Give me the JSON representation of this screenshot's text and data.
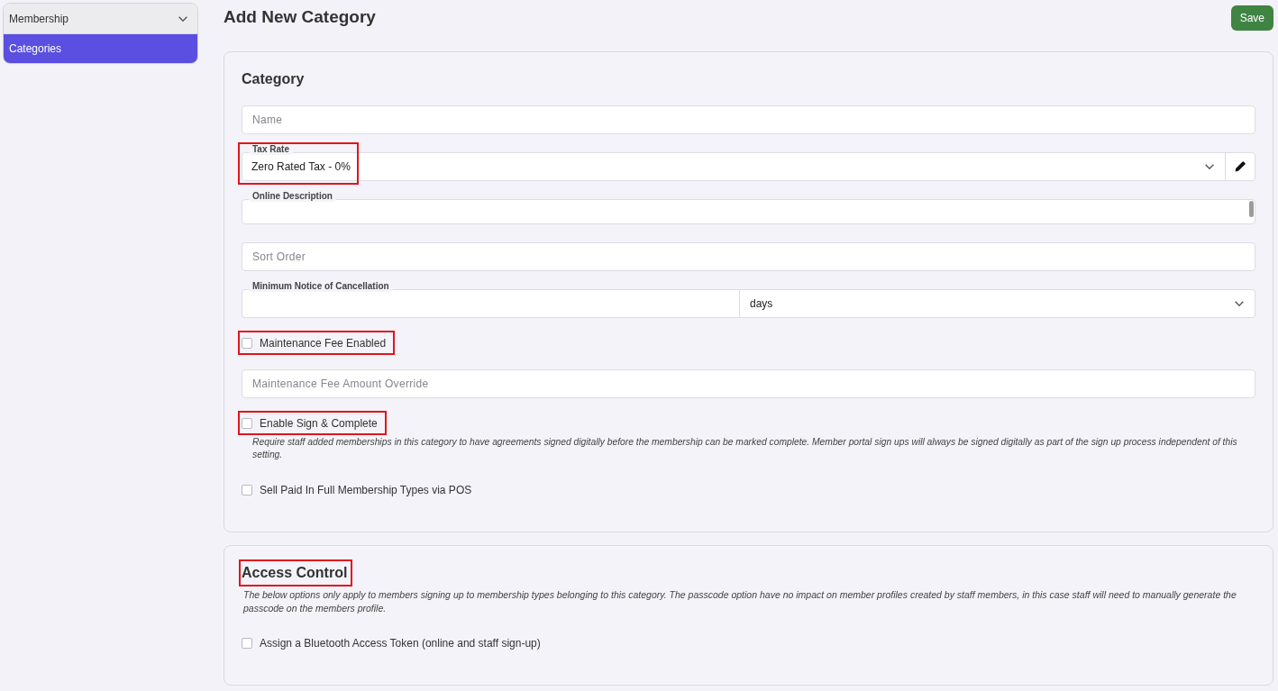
{
  "sidebar": {
    "group": {
      "label": "Membership",
      "expanded": true
    },
    "items": [
      {
        "label": "Categories",
        "selected": true
      }
    ]
  },
  "header": {
    "title": "Add New Category",
    "save_button": "Save"
  },
  "sections": [
    {
      "title": "Category",
      "highlighted": false,
      "fields": [
        {
          "kind": "text",
          "placeholder": "Name",
          "highlighted": false
        },
        {
          "kind": "select",
          "label": "Tax Rate",
          "value": "Zero Rated Tax - 0%",
          "edit_button": true,
          "highlighted": true
        },
        {
          "kind": "textarea",
          "label": "Online Description",
          "highlighted": false
        },
        {
          "kind": "text",
          "placeholder": "Sort Order",
          "highlighted": false
        },
        {
          "kind": "split",
          "label": "Minimum Notice of Cancellation",
          "unit": "days",
          "highlighted": false
        },
        {
          "kind": "checkbox",
          "label": "Maintenance Fee Enabled",
          "checked": false,
          "highlighted": true
        },
        {
          "kind": "text",
          "placeholder": "Maintenance Fee Amount Override",
          "highlighted": false
        },
        {
          "kind": "checkbox",
          "label": "Enable Sign & Complete",
          "checked": false,
          "highlighted": true,
          "help": "Require staff added memberships in this category to have agreements signed digitally before the membership can be marked complete. Member portal sign ups will always be signed digitally as part of the sign up process independent of this setting."
        },
        {
          "kind": "checkbox",
          "label": "Sell Paid In Full Membership Types via POS",
          "checked": false,
          "highlighted": false
        }
      ]
    },
    {
      "title": "Access Control",
      "highlighted": true,
      "note": "The below options only apply to members signing up to membership types belonging to this category. The passcode option have no impact on member profiles created by staff members, in this case staff will need to manually generate the passcode on the members profile.",
      "fields": [
        {
          "kind": "checkbox",
          "label": "Assign a Bluetooth Access Token (online and staff sign-up)",
          "checked": false,
          "highlighted": false
        }
      ]
    }
  ]
}
